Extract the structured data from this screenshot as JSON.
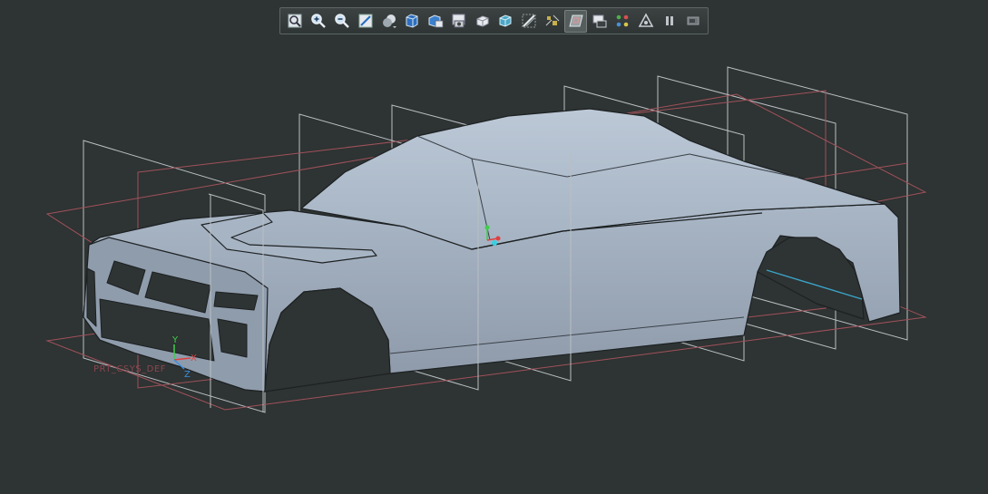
{
  "toolbar": {
    "buttons": [
      {
        "name": "refit-icon",
        "active": false
      },
      {
        "name": "zoom-in-icon",
        "active": false
      },
      {
        "name": "zoom-out-icon",
        "active": false
      },
      {
        "name": "repaint-icon",
        "active": false
      },
      {
        "name": "display-style-icon",
        "active": false
      },
      {
        "name": "saved-views-icon",
        "active": false
      },
      {
        "name": "view-manager-icon",
        "active": false
      },
      {
        "name": "perspective-view-icon",
        "active": false
      },
      {
        "name": "section-icon",
        "active": false
      },
      {
        "name": "appearance-icon",
        "active": false
      },
      {
        "name": "sketch-view-icon",
        "active": false
      },
      {
        "name": "datum-display-icon",
        "active": false
      },
      {
        "name": "datum-planes-icon",
        "active": true
      },
      {
        "name": "datum-axes-icon",
        "active": false
      },
      {
        "name": "point-display-icon",
        "active": false
      },
      {
        "name": "annotation-display-icon",
        "active": false
      },
      {
        "name": "pause-icon",
        "active": false
      },
      {
        "name": "spin-center-icon",
        "active": false
      }
    ]
  },
  "viewport": {
    "csys_label": "PRT_CSYS_DEF",
    "triad_labels": {
      "y": "Y",
      "x": "X",
      "z": "Z"
    },
    "colors": {
      "background": "#2e3333",
      "body": "#98a7b8",
      "datum_plane_edge": "#b9bfc2",
      "datum_plane_red": "#a0525b",
      "edge": "#1d2122"
    }
  }
}
